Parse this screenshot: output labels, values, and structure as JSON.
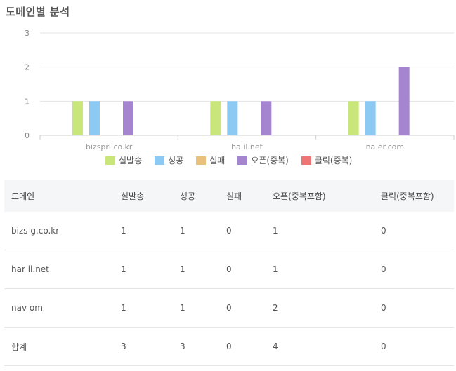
{
  "page_title": "도메인별 분석",
  "chart_data": {
    "type": "bar",
    "categories": [
      "bizspri    co.kr",
      "ha     il.net",
      "na     er.com"
    ],
    "series": [
      {
        "name": "실발송",
        "color": "#c8e67a",
        "values": [
          1,
          1,
          1
        ]
      },
      {
        "name": "성공",
        "color": "#8ccaf4",
        "values": [
          1,
          1,
          1
        ]
      },
      {
        "name": "실패",
        "color": "#eac07e",
        "values": [
          0,
          0,
          0
        ]
      },
      {
        "name": "오픈(중복)",
        "color": "#a585cf",
        "values": [
          1,
          1,
          2
        ]
      },
      {
        "name": "클릭(중복)",
        "color": "#ee7575",
        "values": [
          0,
          0,
          0
        ]
      }
    ],
    "yticks": [
      "0",
      "1",
      "2",
      "3"
    ],
    "ylim": [
      0,
      3
    ],
    "grid": true,
    "legend": "bottom"
  },
  "table": {
    "headers": [
      "도메인",
      "실발송",
      "성공",
      "실패",
      "오픈(중복포함)",
      "클릭(중복포함)"
    ],
    "rows": [
      [
        "bizs     g.co.kr",
        "1",
        "1",
        "0",
        "1",
        "0"
      ],
      [
        "har     il.net",
        "1",
        "1",
        "0",
        "1",
        "0"
      ],
      [
        "nav     om",
        "1",
        "1",
        "0",
        "2",
        "0"
      ],
      [
        "합계",
        "3",
        "3",
        "0",
        "4",
        "0"
      ]
    ]
  }
}
